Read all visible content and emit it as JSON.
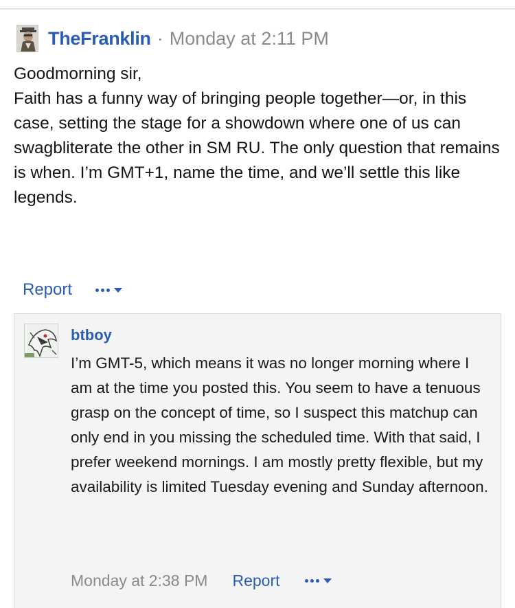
{
  "post": {
    "author": "TheFranklin",
    "separator": "·",
    "timestamp": "Monday at 2:11 PM",
    "body_lines": [
      "Goodmorning sir,",
      "Faith has a funny way of bringing people together—or, in this case, setting the stage for a showdown where one of us can swagbliterate the other in SM RU. The only question that remains is when. I’m GMT+1, name the time, and we’ll settle this like legends."
    ],
    "actions": {
      "report": "Report"
    }
  },
  "reply": {
    "author": "btboy",
    "body": "I’m GMT-5, which means it was no longer morning where I am at the time you posted this. You seem to have a tenuous grasp on the concept of time, so I suspect this matchup can only end in you missing the scheduled time. With that said, I prefer weekend mornings. I am mostly pretty flexible, but my availability is limited Tuesday evening and Sunday afternoon.",
    "timestamp": "Monday at 2:38 PM",
    "actions": {
      "report": "Report"
    }
  },
  "icons": {
    "more": "more-dots-icon",
    "dropdown": "caret-down-icon"
  },
  "colors": {
    "link": "#2a5cb5",
    "meta": "#8a8a8a",
    "reply_bg": "#f4f4f4",
    "text": "#141414"
  }
}
